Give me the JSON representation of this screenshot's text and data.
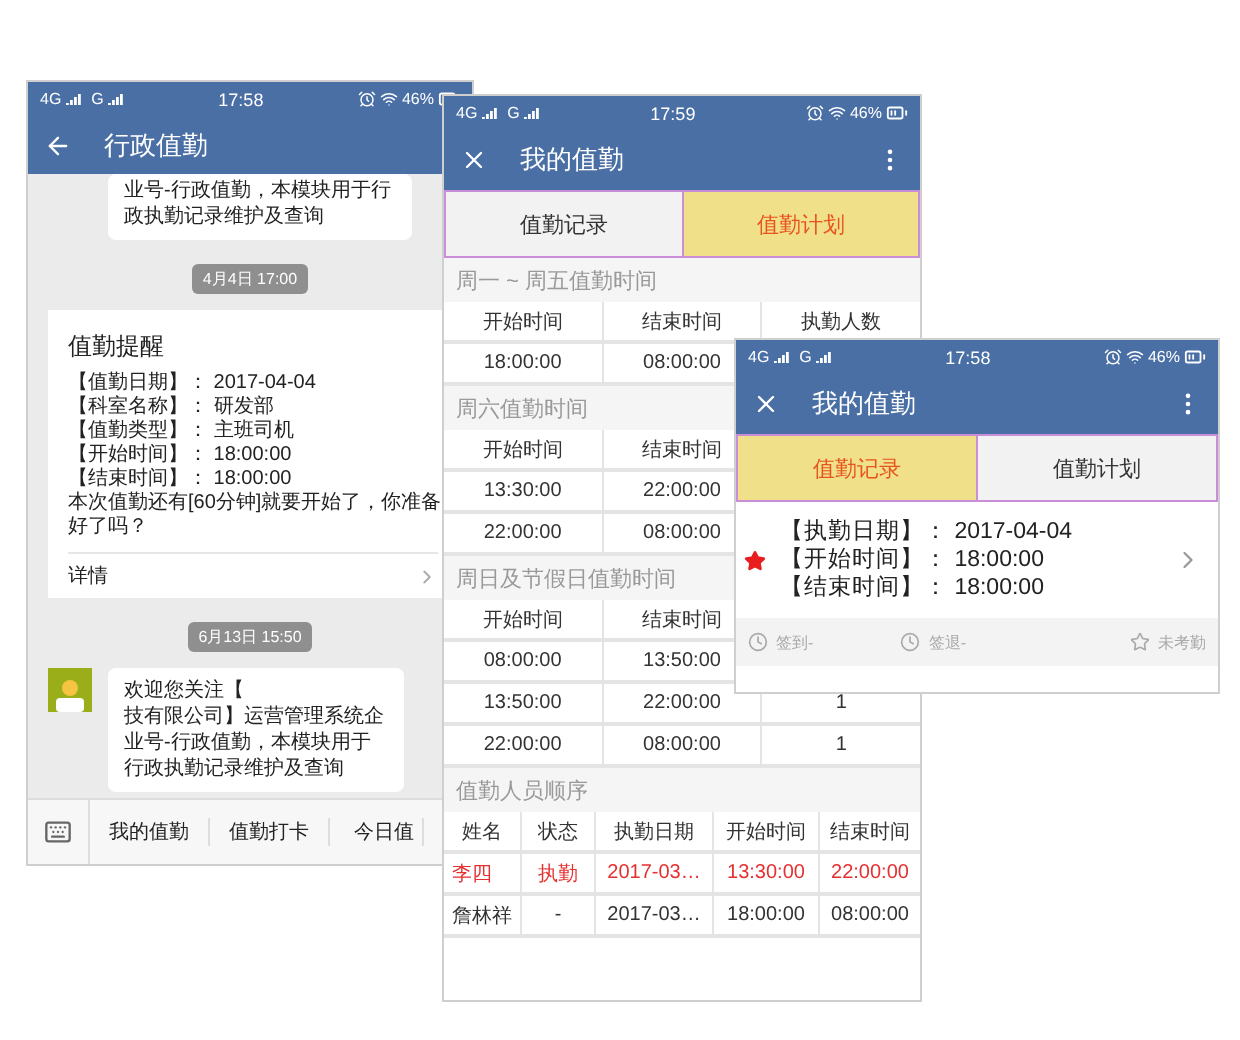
{
  "chat_screen": {
    "status_bar": {
      "network_1": "4G",
      "network_2": "G",
      "time": "17:58",
      "battery": "46%"
    },
    "header": {
      "title": "行政值勤"
    },
    "messages": [
      {
        "kind": "bubble",
        "text": "业号-行政值勤，本模块用于行政执勤记录维护及查询"
      },
      {
        "kind": "timestamp",
        "text": "4月4日 17:00"
      },
      {
        "kind": "card",
        "title": "值勤提醒",
        "lines": [
          "【值勤日期】： 2017-04-04",
          "【科室名称】： 研发部",
          "【值勤类型】： 主班司机",
          "【开始时间】： 18:00:00",
          "【结束时间】： 18:00:00"
        ],
        "notice": "本次值勤还有[60分钟]就要开始了，你准备好了吗？",
        "link": "详情"
      },
      {
        "kind": "timestamp",
        "text": "6月13日 15:50"
      },
      {
        "kind": "welcome",
        "first_line": "欢迎您关注【",
        "text": "技有限公司】运营管理系统企业号-行政值勤，本模块用于行政执勤记录维护及查询"
      }
    ],
    "menu": [
      "我的值勤",
      "值勤打卡",
      "今日值"
    ]
  },
  "plan_screen": {
    "status_bar": {
      "network_1": "4G",
      "network_2": "G",
      "time": "17:59",
      "battery": "46%"
    },
    "header": {
      "title": "我的值勤"
    },
    "tabs": [
      {
        "label": "值勤记录",
        "selected": false
      },
      {
        "label": "值勤计划",
        "selected": true
      }
    ],
    "sections": [
      {
        "title": "周一 ~ 周五值勤时间",
        "columns": [
          "开始时间",
          "结束时间",
          "执勤人数"
        ],
        "rows": [
          [
            "18:00:00",
            "08:00:00"
          ]
        ]
      },
      {
        "title": "周六值勤时间",
        "columns": [
          "开始时间",
          "结束时间"
        ],
        "rows": [
          [
            "13:30:00",
            "22:00:00"
          ],
          [
            "22:00:00",
            "08:00:00"
          ]
        ]
      },
      {
        "title": "周日及节假日值勤时间",
        "columns": [
          "开始时间",
          "结束时间"
        ],
        "rows": [
          [
            "08:00:00",
            "13:50:00"
          ],
          [
            "13:50:00",
            "22:00:00",
            "1"
          ],
          [
            "22:00:00",
            "08:00:00",
            "1"
          ]
        ]
      }
    ],
    "roster": {
      "title": "值勤人员顺序",
      "columns": [
        "姓名",
        "状态",
        "执勤日期",
        "开始时间",
        "结束时间"
      ],
      "rows": [
        {
          "highlighted": true,
          "cells": [
            "李四",
            "执勤",
            "2017-03…",
            "13:30:00",
            "22:00:00"
          ]
        },
        {
          "highlighted": false,
          "cells": [
            "詹林祥",
            "-",
            "2017-03…",
            "18:00:00",
            "08:00:00"
          ]
        }
      ]
    }
  },
  "record_screen": {
    "status_bar": {
      "network_1": "4G",
      "network_2": "G",
      "time": "17:58",
      "battery": "46%"
    },
    "header": {
      "title": "我的值勤"
    },
    "tabs": [
      {
        "label": "值勤记录",
        "selected": true
      },
      {
        "label": "值勤计划",
        "selected": false
      }
    ],
    "record": {
      "flagged": true,
      "lines": [
        "【执勤日期】： 2017-04-04",
        "【开始时间】： 18:00:00",
        "【结束时间】： 18:00:00"
      ]
    },
    "footer": [
      {
        "kind": "clock",
        "label": "签到-"
      },
      {
        "kind": "clock",
        "label": "签退-"
      },
      {
        "kind": "star",
        "label": "未考勤"
      }
    ]
  }
}
